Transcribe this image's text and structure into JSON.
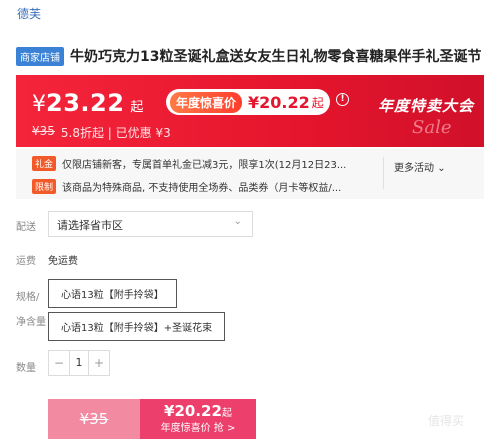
{
  "brand": "德芙",
  "product": {
    "shop_tag": "商家店铺",
    "title": "牛奶巧克力13粒圣诞礼盒送女友生日礼物零食喜糖果伴手礼圣诞节"
  },
  "price_banner": {
    "currency": "¥",
    "price": "23.22",
    "qi": "起",
    "promo_tag": "年度惊喜价",
    "promo_price": "¥20.22",
    "promo_qi": "起",
    "info_glyph": "!",
    "original_price": "¥35",
    "discount_text": "5.8折起 | 已优惠 ¥3",
    "promo_title": "年度特卖大会",
    "promo_sale": "Sale",
    "colors": {
      "banner_red": "#e5152d",
      "promo_orange": "#ff5a36"
    }
  },
  "activities": {
    "items": [
      {
        "badge": "礼金",
        "text": "仅限店铺新客，专属首单礼金已减3元，限享1次(12月12日23..."
      },
      {
        "badge": "限制",
        "text": "该商品为特殊商品, 不支持使用全场券、品类券（月卡等权益/..."
      }
    ],
    "more_label": "更多活动",
    "more_icon": "chevron-down-icon"
  },
  "shipping": {
    "label": "配送",
    "placeholder": "请选择省市区",
    "fee_label": "运费",
    "fee_value": "免运费"
  },
  "options": {
    "spec_label": "规格/",
    "spec_value": "心语13粒【附手拎袋】",
    "net_label": "净含量",
    "net_value": "心语13粒【附手拎袋】+圣诞花束"
  },
  "quantity": {
    "label": "数量",
    "minus": "−",
    "value": "1",
    "plus": "+"
  },
  "buy": {
    "original_price": "¥35",
    "price": "¥20.22",
    "qi": "起",
    "tag_text": "年度惊喜价 抢 >"
  },
  "watermark": "值得买"
}
